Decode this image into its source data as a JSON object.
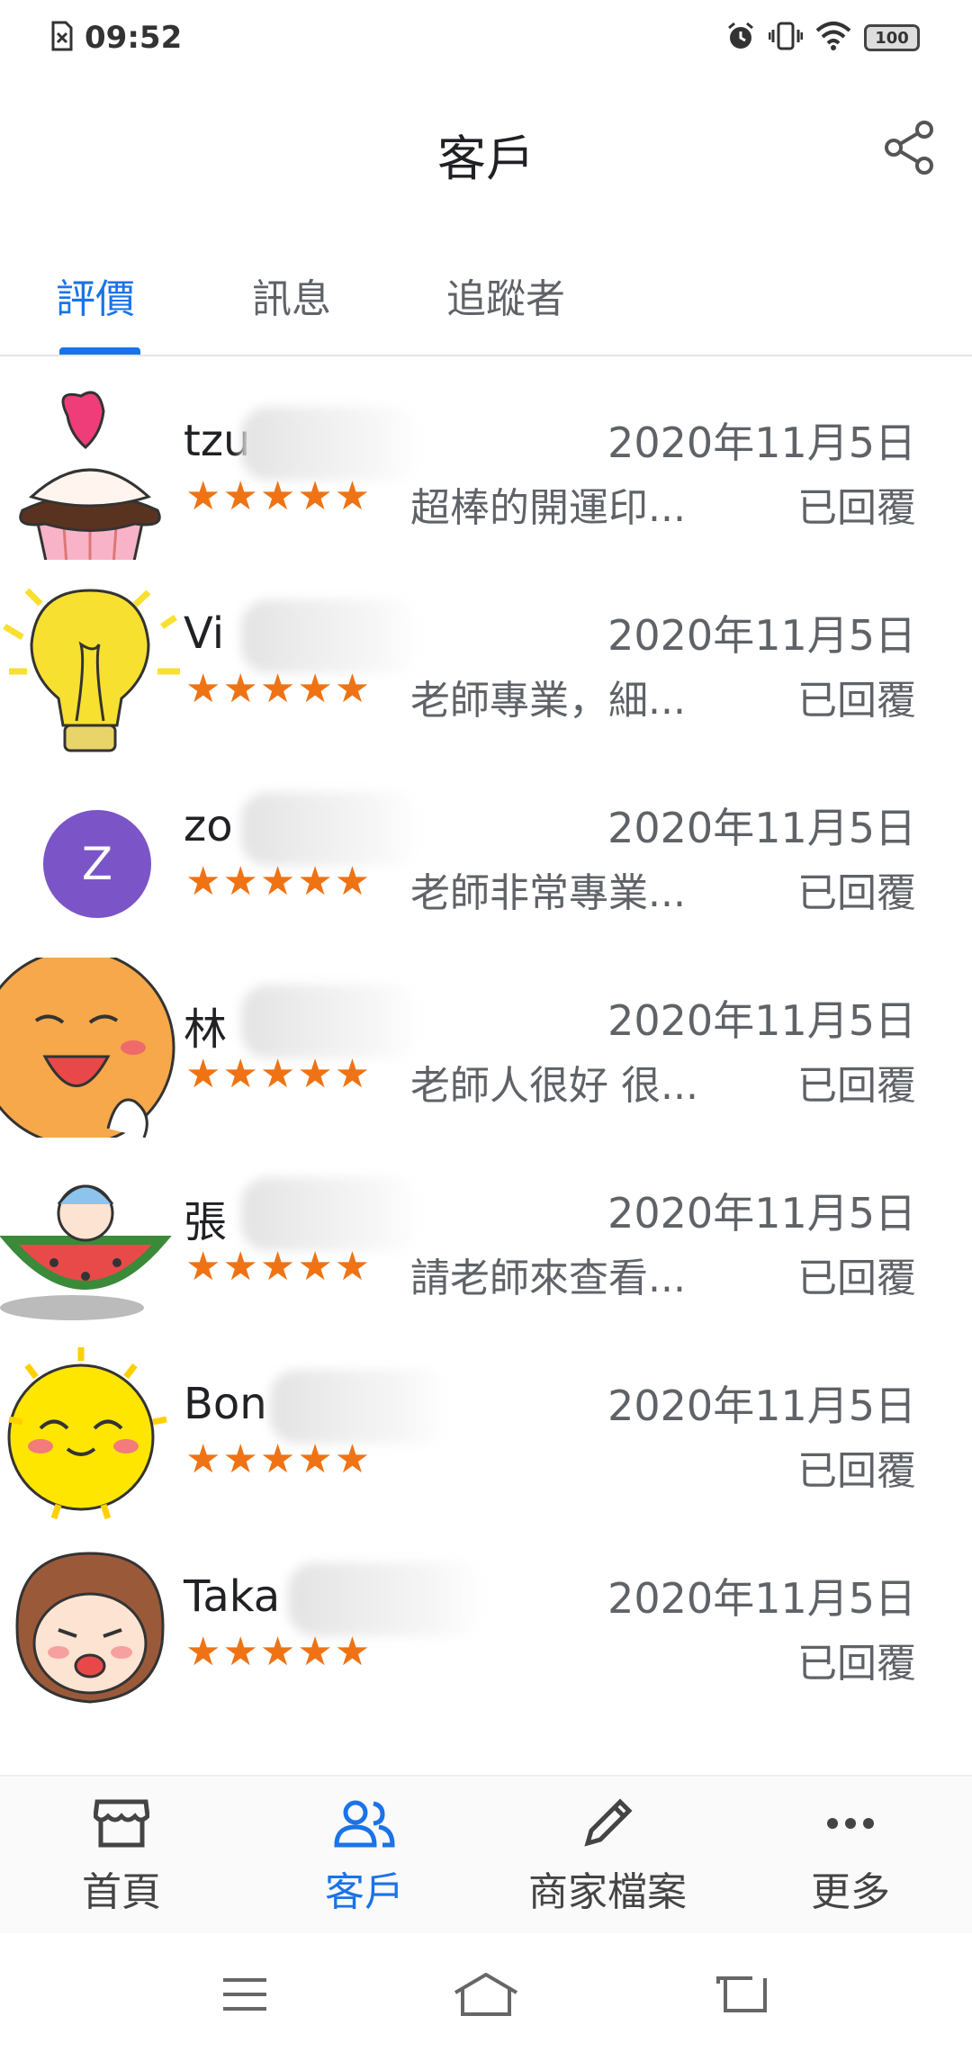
{
  "status_bar": {
    "time": "09:52",
    "battery": "100",
    "icons": [
      "sim-error-icon",
      "alarm-icon",
      "vibrate-icon",
      "wifi-icon",
      "battery-icon"
    ]
  },
  "app_bar": {
    "title": "客戶",
    "share_icon": "share-icon"
  },
  "tabs": [
    {
      "label": "評價",
      "active": true
    },
    {
      "label": "訊息",
      "active": false
    },
    {
      "label": "追蹤者",
      "active": false
    }
  ],
  "reviews": [
    {
      "name": "tzu",
      "date": "2020年11月5日",
      "stars": "★★★★★",
      "snippet": "超棒的開運印...",
      "status": "已回覆",
      "avatar": "cupcake"
    },
    {
      "name": "Vi",
      "date": "2020年11月5日",
      "stars": "★★★★★",
      "snippet": "老師專業，細...",
      "status": "已回覆",
      "avatar": "lightbulb"
    },
    {
      "name": "zo",
      "date": "2020年11月5日",
      "stars": "★★★★★",
      "snippet": "老師非常專業...",
      "status": "已回覆",
      "avatar": "letter",
      "avatar_letter": "Z"
    },
    {
      "name": "林",
      "date": "2020年11月5日",
      "stars": "★★★★★",
      "snippet": "老師人很好 很...",
      "status": "已回覆",
      "avatar": "orange-face"
    },
    {
      "name": "張",
      "date": "2020年11月5日",
      "stars": "★★★★★",
      "snippet": "請老師來查看...",
      "status": "已回覆",
      "avatar": "watermelon"
    },
    {
      "name": "Bon",
      "date": "2020年11月5日",
      "stars": "★★★★★",
      "snippet": "",
      "status": "已回覆",
      "avatar": "sun"
    },
    {
      "name": "Taka",
      "date": "2020年11月5日",
      "stars": "★★★★★",
      "snippet": "",
      "status": "已回覆",
      "avatar": "girl"
    }
  ],
  "bottom_nav": [
    {
      "label": "首頁",
      "icon": "store-icon",
      "active": false
    },
    {
      "label": "客戶",
      "icon": "customers-icon",
      "active": true
    },
    {
      "label": "商家檔案",
      "icon": "edit-profile-icon",
      "active": false
    },
    {
      "label": "更多",
      "icon": "more-icon",
      "active": false
    }
  ],
  "colors": {
    "accent": "#1a73e8",
    "star": "#ef7314",
    "secondary_text": "#5f6368",
    "letter_avatar": "#7b55c7"
  }
}
